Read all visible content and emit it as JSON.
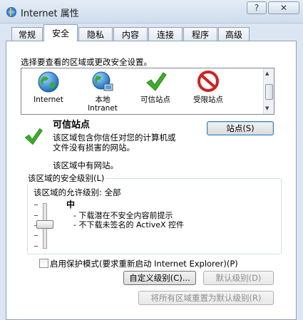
{
  "window": {
    "title": "Internet 属性",
    "help_glyph": "?",
    "close_glyph": "✕"
  },
  "tabs": [
    "常规",
    "安全",
    "隐私",
    "内容",
    "连接",
    "程序",
    "高级"
  ],
  "active_tab": "安全",
  "instruction": "选择要查看的区域或更改安全设置。",
  "zones": [
    {
      "label1": "Internet",
      "label2": "",
      "icon": "globe-icon"
    },
    {
      "label1": "本地",
      "label2": "Intranet",
      "icon": "intranet-globe-icon"
    },
    {
      "label1": "可信站点",
      "label2": "",
      "icon": "checkmark-icon"
    },
    {
      "label1": "受限站点",
      "label2": "",
      "icon": "restricted-icon"
    }
  ],
  "selected_zone": "可信站点",
  "zone_title": "可信站点",
  "zone_desc_line1": "该区域包含你信任对您的计算机或",
  "zone_desc_line2": "文件没有损害的网站。",
  "zone_has_sites": "该区域中有网站。",
  "sites_button": "站点(S)",
  "security_level_group": "该区域的安全级别(L)",
  "allowed_levels": "该区域的允许级别: 全部",
  "level_name": "中",
  "level_bullet1": "- 下载潜在不安全内容前提示",
  "level_bullet2": "- 不下载未签名的 ActiveX 控件",
  "protected_mode_label": "启用保护模式(要求重新启动 Internet Explorer)(P)",
  "protected_mode_checked": false,
  "custom_level_button": "自定义级别(C)...",
  "default_level_button": "默认级别(D)",
  "reset_all_button": "将所有区域重置为默认级别(R)",
  "colors": {
    "globe": "#2a7fc9",
    "check": "#3fae2a",
    "restricted": "#d32020",
    "focus_border": "#3c7fb1"
  }
}
